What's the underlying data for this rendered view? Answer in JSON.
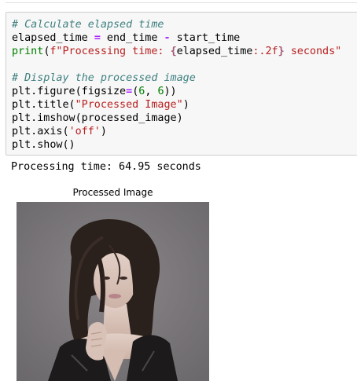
{
  "cell": {
    "lines": [
      [
        {
          "t": "# Calculate elapsed time",
          "c": "cm"
        }
      ],
      [
        {
          "t": "elapsed_time "
        },
        {
          "t": "=",
          "c": "op"
        },
        {
          "t": " end_time "
        },
        {
          "t": "-",
          "c": "op"
        },
        {
          "t": " start_time"
        }
      ],
      [
        {
          "t": "print",
          "c": "bi"
        },
        {
          "t": "("
        },
        {
          "t": "f\"Processing time: ",
          "c": "st"
        },
        {
          "t": "{",
          "c": "si"
        },
        {
          "t": "elapsed_time"
        },
        {
          "t": ":.2f",
          "c": "st"
        },
        {
          "t": "}",
          "c": "si"
        },
        {
          "t": " seconds\"",
          "c": "st"
        }
      ],
      [
        {
          "t": ""
        }
      ],
      [
        {
          "t": "# Display the processed image",
          "c": "cm"
        }
      ],
      [
        {
          "t": "plt.figure(figsize"
        },
        {
          "t": "=",
          "c": "op"
        },
        {
          "t": "("
        },
        {
          "t": "6",
          "c": "nu"
        },
        {
          "t": ", "
        },
        {
          "t": "6",
          "c": "nu"
        },
        {
          "t": "))"
        }
      ],
      [
        {
          "t": "plt.title("
        },
        {
          "t": "\"Processed Image\"",
          "c": "st"
        },
        {
          "t": ")"
        }
      ],
      [
        {
          "t": "plt.imshow(processed_image)"
        }
      ],
      [
        {
          "t": "plt.axis("
        },
        {
          "t": "'off'",
          "c": "st"
        },
        {
          "t": ")"
        }
      ],
      [
        {
          "t": "plt.show()"
        }
      ]
    ]
  },
  "output": {
    "stdout": "Processing time: 64.95 seconds",
    "figure_title": "Processed Image"
  }
}
